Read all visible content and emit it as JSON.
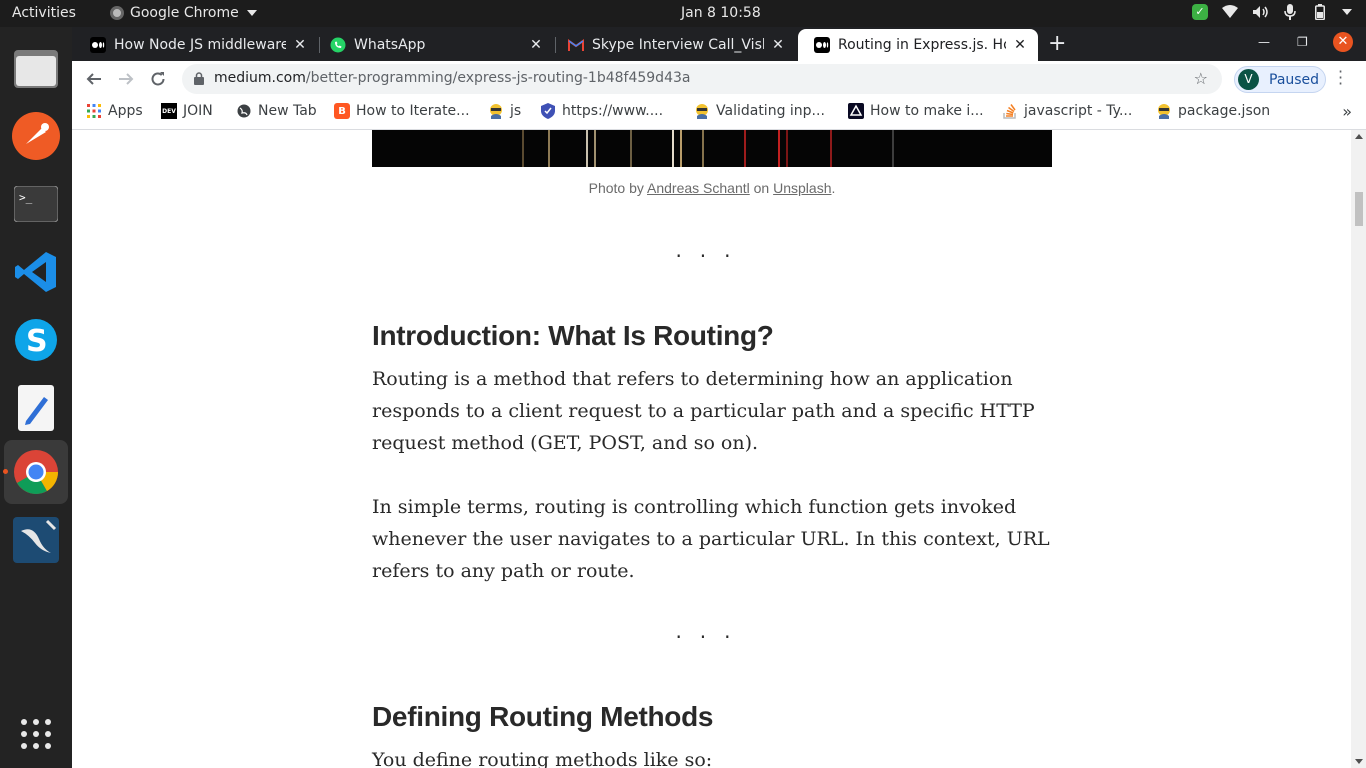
{
  "system": {
    "activities": "Activities",
    "app_name": "Google Chrome",
    "clock": "Jan 8  10:58"
  },
  "tabs": [
    {
      "title": "How Node JS middleware",
      "favicon": "medium-icon",
      "active": false
    },
    {
      "title": "WhatsApp",
      "favicon": "whatsapp-icon",
      "active": false
    },
    {
      "title": "Skype Interview Call_Vish",
      "favicon": "gmail-icon",
      "active": false
    },
    {
      "title": "Routing in Express.js. Hov",
      "favicon": "medium-icon",
      "active": true
    }
  ],
  "omnibox": {
    "domain": "medium.com",
    "path": "/better-programming/express-js-routing-1b48f459d43a"
  },
  "profile": {
    "initial": "V",
    "label": "Paused"
  },
  "bookmarks": [
    {
      "label": "Apps",
      "icon": "apps-grid-icon"
    },
    {
      "label": "JOIN",
      "icon": "dev-icon"
    },
    {
      "label": "New Tab",
      "icon": "globe-icon"
    },
    {
      "label": "How to Iterate...",
      "icon": "blogger-icon"
    },
    {
      "label": "js",
      "icon": "avatar-icon"
    },
    {
      "label": "https://www....",
      "icon": "shield-icon"
    },
    {
      "label": "Validating inp...",
      "icon": "avatar-icon"
    },
    {
      "label": "How to make i...",
      "icon": "dev-logo-icon"
    },
    {
      "label": "javascript - Ty...",
      "icon": "stackoverflow-icon"
    },
    {
      "label": "package.json",
      "icon": "avatar-icon"
    }
  ],
  "article": {
    "caption_prefix": "Photo by ",
    "caption_author": "Andreas Schantl",
    "caption_mid": " on ",
    "caption_source": "Unsplash",
    "caption_suffix": ".",
    "separator": "...",
    "heading1": "Introduction: What Is Routing?",
    "para1": "Routing is a method that refers to determining how an application responds to a client request to a particular path and a specific HTTP request method (GET, POST, and so on).",
    "para2": "In simple terms, routing is controlling which function gets invoked whenever the user navigates to a particular URL. In this context, URL refers to any path or route.",
    "heading2": "Defining Routing Methods",
    "para3": "You define routing methods like so:"
  },
  "colors": {
    "accent": "#e95420",
    "profile_bg": "#0b5345"
  }
}
